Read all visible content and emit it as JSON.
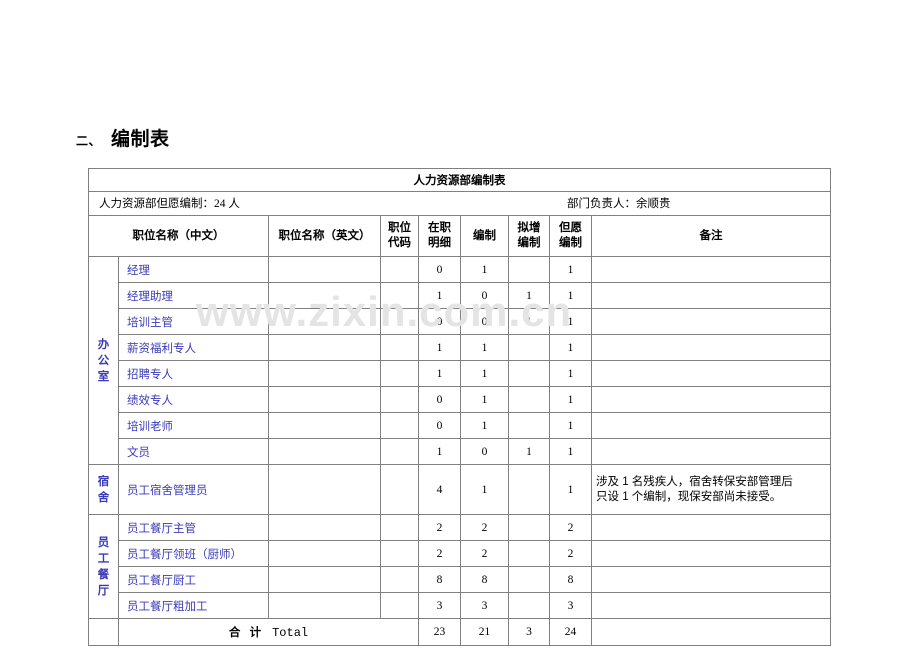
{
  "document": {
    "section_number": "二、",
    "section_title": "编制表",
    "watermark": "www.zixin.com.cn"
  },
  "table": {
    "title": "人力资源部编制表",
    "subheader_left": "人力资源部但愿编制：24 人",
    "subheader_right": "部门负责人：余顺贵",
    "columns": {
      "position_cn": "职位名称（中文）",
      "position_en": "职位名称（英文）",
      "position_code_l1": "职位",
      "position_code_l2": "代码",
      "on_duty_l1": "在职",
      "on_duty_l2": "明细",
      "establishment": "编制",
      "planned_add_l1": "拟增",
      "planned_add_l2": "编制",
      "desired_l1": "但愿",
      "desired_l2": "编制",
      "remarks": "备注"
    },
    "groups": [
      {
        "label_chars": [
          "办",
          "公",
          "室"
        ],
        "rows": [
          {
            "position_cn": "经理",
            "position_en": "",
            "code": "",
            "on_duty": "0",
            "establishment": "1",
            "planned_add": "",
            "desired": "1",
            "remarks_l1": "",
            "remarks_l2": ""
          },
          {
            "position_cn": "经理助理",
            "position_en": "",
            "code": "",
            "on_duty": "1",
            "establishment": "0",
            "planned_add": "1",
            "desired": "1",
            "remarks_l1": "",
            "remarks_l2": ""
          },
          {
            "position_cn": "培训主管",
            "position_en": "",
            "code": "",
            "on_duty": "0",
            "establishment": "0",
            "planned_add": "1",
            "desired": "1",
            "remarks_l1": "",
            "remarks_l2": ""
          },
          {
            "position_cn": "薪资福利专人",
            "position_en": "",
            "code": "",
            "on_duty": "1",
            "establishment": "1",
            "planned_add": "",
            "desired": "1",
            "remarks_l1": "",
            "remarks_l2": ""
          },
          {
            "position_cn": "招聘专人",
            "position_en": "",
            "code": "",
            "on_duty": "1",
            "establishment": "1",
            "planned_add": "",
            "desired": "1",
            "remarks_l1": "",
            "remarks_l2": ""
          },
          {
            "position_cn": "绩效专人",
            "position_en": "",
            "code": "",
            "on_duty": "0",
            "establishment": "1",
            "planned_add": "",
            "desired": "1",
            "remarks_l1": "",
            "remarks_l2": ""
          },
          {
            "position_cn": "培训老师",
            "position_en": "",
            "code": "",
            "on_duty": "0",
            "establishment": "1",
            "planned_add": "",
            "desired": "1",
            "remarks_l1": "",
            "remarks_l2": ""
          },
          {
            "position_cn": "文员",
            "position_en": "",
            "code": "",
            "on_duty": "1",
            "establishment": "0",
            "planned_add": "1",
            "desired": "1",
            "remarks_l1": "",
            "remarks_l2": ""
          }
        ]
      },
      {
        "label_chars": [
          "宿",
          "舍"
        ],
        "rows": [
          {
            "position_cn": "员工宿舍管理员",
            "position_en": "",
            "code": "",
            "on_duty": "4",
            "establishment": "1",
            "planned_add": "",
            "desired": "1",
            "remarks_l1": "涉及 1 名残疾人，宿舍转保安部管理后",
            "remarks_l2": "只设 1 个编制，现保安部尚未接受。"
          }
        ]
      },
      {
        "label_chars": [
          "员",
          "工",
          "餐",
          "厅"
        ],
        "rows": [
          {
            "position_cn": "员工餐厅主管",
            "position_en": "",
            "code": "",
            "on_duty": "2",
            "establishment": "2",
            "planned_add": "",
            "desired": "2",
            "remarks_l1": "",
            "remarks_l2": ""
          },
          {
            "position_cn": "员工餐厅领班（厨师）",
            "position_en": "",
            "code": "",
            "on_duty": "2",
            "establishment": "2",
            "planned_add": "",
            "desired": "2",
            "remarks_l1": "",
            "remarks_l2": ""
          },
          {
            "position_cn": "员工餐厅厨工",
            "position_en": "",
            "code": "",
            "on_duty": "8",
            "establishment": "8",
            "planned_add": "",
            "desired": "8",
            "remarks_l1": "",
            "remarks_l2": ""
          },
          {
            "position_cn": "员工餐厅粗加工",
            "position_en": "",
            "code": "",
            "on_duty": "3",
            "establishment": "3",
            "planned_add": "",
            "desired": "3",
            "remarks_l1": "",
            "remarks_l2": ""
          }
        ]
      }
    ],
    "total": {
      "label_cn": "合 计",
      "label_en": "Total",
      "on_duty": "23",
      "establishment": "21",
      "planned_add": "3",
      "desired": "24",
      "remarks": ""
    }
  }
}
